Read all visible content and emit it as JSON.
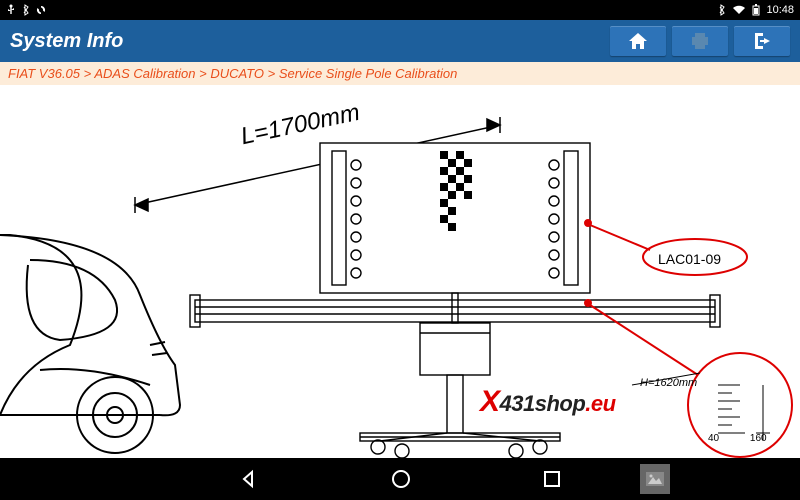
{
  "status": {
    "time": "10:48"
  },
  "header": {
    "title": "System Info",
    "home_label": "Home",
    "print_label": "Print",
    "exit_label": "Exit"
  },
  "breadcrumb": {
    "text": "FIAT V36.05 > ADAS Calibration > DUCATO > Service Single Pole Calibration"
  },
  "diagram": {
    "length_label": "L=1700mm",
    "height_label": "H=1620mm",
    "part_number": "LAC01-09",
    "ruler_min": "40",
    "ruler_max": "160"
  },
  "watermark": {
    "x": "X",
    "mid": "431",
    "rest": "shop",
    "eu": ".eu"
  },
  "nav": {
    "back": "Back",
    "home": "Home",
    "recent": "Recent",
    "gallery": "Gallery"
  }
}
